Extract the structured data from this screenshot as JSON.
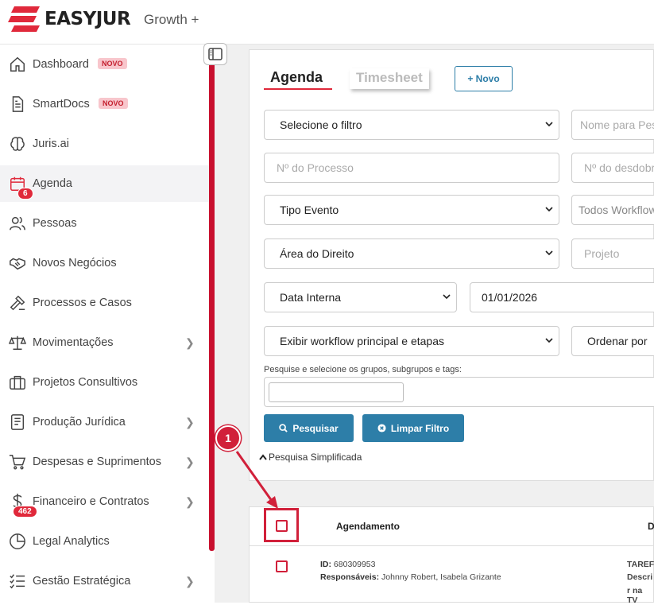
{
  "header": {
    "brand": "EASYJUR",
    "plan": "Growth +"
  },
  "sidebar": {
    "items": [
      {
        "label": "Dashboard",
        "badge": "NOVO",
        "icon": "home-icon"
      },
      {
        "label": "SmartDocs",
        "badge": "NOVO",
        "icon": "document-icon"
      },
      {
        "label": "Juris.ai",
        "icon": "brain-icon"
      },
      {
        "label": "Agenda",
        "count": "6",
        "icon": "calendar-icon",
        "active": true
      },
      {
        "label": "Pessoas",
        "icon": "people-icon"
      },
      {
        "label": "Novos Negócios",
        "icon": "handshake-icon"
      },
      {
        "label": "Processos e Casos",
        "icon": "gavel-icon"
      },
      {
        "label": "Movimentações",
        "icon": "scale-icon",
        "chevron": true
      },
      {
        "label": "Projetos Consultivos",
        "icon": "briefcase-icon"
      },
      {
        "label": "Produção Jurídica",
        "icon": "notebook-icon",
        "chevron": true
      },
      {
        "label": "Despesas e Suprimentos",
        "icon": "cart-icon",
        "chevron": true
      },
      {
        "label": "Financeiro e Contratos",
        "count": "462",
        "icon": "dollar-icon",
        "chevron": true
      },
      {
        "label": "Legal Analytics",
        "icon": "pie-chart-icon"
      },
      {
        "label": "Gestão Estratégica",
        "icon": "checklist-icon",
        "chevron": true
      }
    ]
  },
  "tabs": {
    "agenda": "Agenda",
    "timesheet": "Timesheet",
    "new_button": "+ Novo"
  },
  "filters": {
    "filter_select": "Selecione o filtro",
    "name_placeholder": "Nome para Pesquisa",
    "process_placeholder": "Nº do Processo",
    "desdobramento_placeholder": "Nº do desdobramento",
    "event_type": "Tipo Evento",
    "workflows": "Todos Workflows",
    "area": "Área do Direito",
    "project_placeholder": "Projeto",
    "date_type": "Data Interna",
    "date_value": "01/01/2026",
    "workflow_display": "Exibir workflow principal e etapas",
    "order_by": "Ordenar por",
    "tags_label": "Pesquise e selecione os grupos, subgrupos e tags:",
    "search_button": "Pesquisar",
    "clear_button": "Limpar Filtro",
    "simple_search": "Pesquisa Simplificada"
  },
  "table": {
    "columns": [
      "Agendamento",
      "D"
    ],
    "rows": [
      {
        "id_label": "ID:",
        "id": "680309953",
        "resp_label": "Responsáveis:",
        "responsaveis": "Johnny Robert, Isabela Grizante",
        "col2_line1": "TAREF",
        "col2_line2": "Descri",
        "col2_line3": "r na TV"
      }
    ]
  },
  "annotation": {
    "step": "1"
  }
}
